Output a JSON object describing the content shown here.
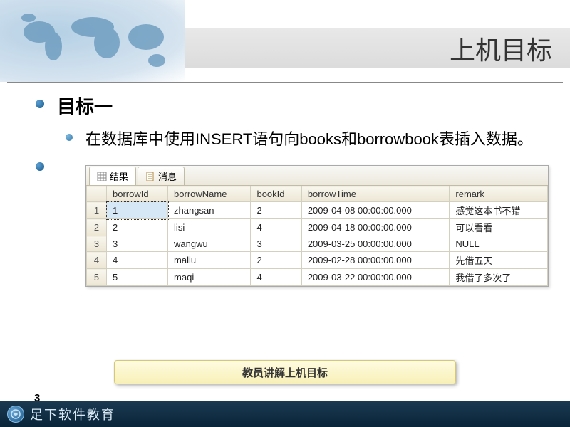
{
  "slide": {
    "title": "上机目标",
    "heading": "目标一",
    "subheading": "在数据库中使用INSERT语句向books和borrowbook表插入数据。",
    "caption": "教员讲解上机目标",
    "page_number": "3"
  },
  "tabs": {
    "results": "结果",
    "messages": "消息"
  },
  "grid": {
    "columns": [
      "borrowId",
      "borrowName",
      "bookId",
      "borrowTime",
      "remark"
    ],
    "rows": [
      {
        "n": "1",
        "borrowId": "1",
        "borrowName": "zhangsan",
        "bookId": "2",
        "borrowTime": "2009-04-08 00:00:00.000",
        "remark": "感觉这本书不错"
      },
      {
        "n": "2",
        "borrowId": "2",
        "borrowName": "lisi",
        "bookId": "4",
        "borrowTime": "2009-04-18 00:00:00.000",
        "remark": "可以看看"
      },
      {
        "n": "3",
        "borrowId": "3",
        "borrowName": "wangwu",
        "bookId": "3",
        "borrowTime": "2009-03-25 00:00:00.000",
        "remark": "NULL"
      },
      {
        "n": "4",
        "borrowId": "4",
        "borrowName": "maliu",
        "bookId": "2",
        "borrowTime": "2009-02-28 00:00:00.000",
        "remark": "先借五天"
      },
      {
        "n": "5",
        "borrowId": "5",
        "borrowName": "maqi",
        "bookId": "4",
        "borrowTime": "2009-03-22 00:00:00.000",
        "remark": "我借了多次了"
      }
    ]
  },
  "footer": {
    "brand": "足下软件教育",
    "logo_glyph": "⊙"
  }
}
